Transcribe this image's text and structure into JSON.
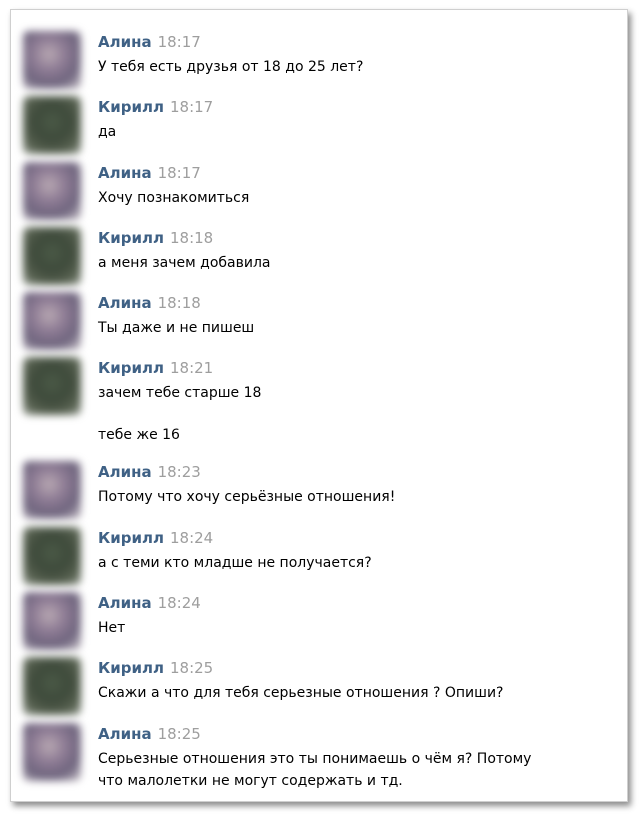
{
  "messages": [
    {
      "author": "Алина",
      "time": "18:17",
      "lines": [
        "У тебя есть друзья от 18 до 25 лет?"
      ]
    },
    {
      "author": "Кирилл",
      "time": "18:17",
      "lines": [
        "да"
      ]
    },
    {
      "author": "Алина",
      "time": "18:17",
      "lines": [
        "Хочу познакомиться"
      ]
    },
    {
      "author": "Кирилл",
      "time": "18:18",
      "lines": [
        "а меня зачем добавила"
      ]
    },
    {
      "author": "Алина",
      "time": "18:18",
      "lines": [
        "Ты даже и не пишеш"
      ]
    },
    {
      "author": "Кирилл",
      "time": "18:21",
      "lines": [
        "зачем тебе старше 18"
      ]
    },
    {
      "lines": [
        "тебе же 16"
      ]
    },
    {
      "author": "Алина",
      "time": "18:23",
      "lines": [
        "Потому что хочу серьёзные отношения!"
      ]
    },
    {
      "author": "Кирилл",
      "time": "18:24",
      "lines": [
        "а с теми кто младше не получается?"
      ]
    },
    {
      "author": "Алина",
      "time": "18:24",
      "lines": [
        "Нет"
      ]
    },
    {
      "author": "Кирилл",
      "time": "18:25",
      "lines": [
        "Скажи а что для тебя серьезные отношения ? Опиши?"
      ]
    },
    {
      "author": "Алина",
      "time": "18:25",
      "lines": [
        "Серьезные отношения это ты понимаешь о чём я? Потому",
        "что малолетки не могут содержать и тд."
      ]
    }
  ]
}
